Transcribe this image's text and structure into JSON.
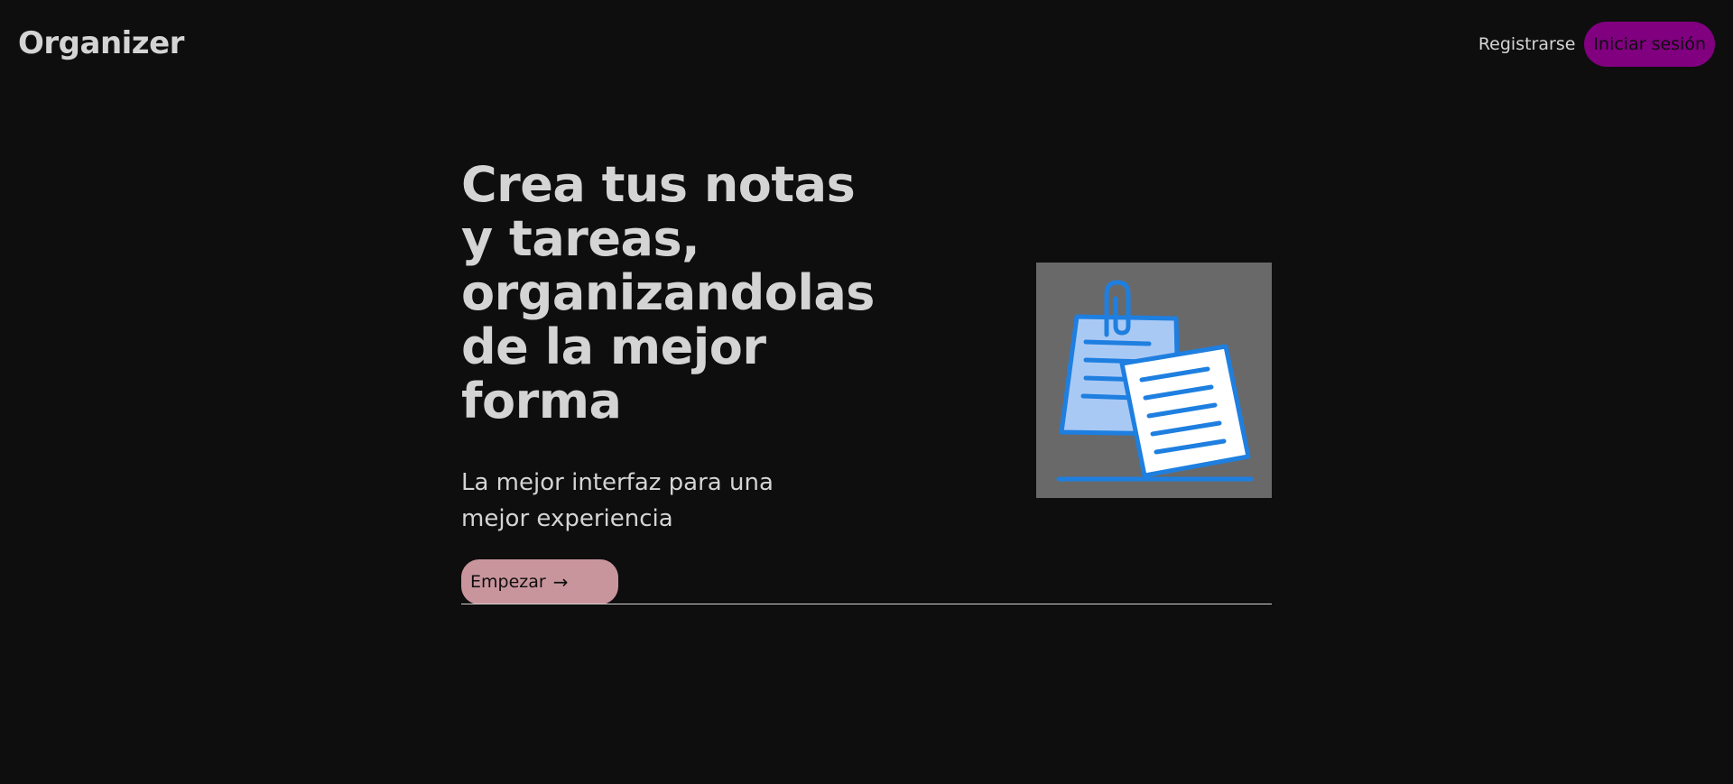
{
  "nav": {
    "logo": "Organizer",
    "register_label": "Registrarse",
    "login_label": "Iniciar sesión"
  },
  "hero": {
    "title": "Crea tus notas y tareas, organizandolas de la mejor forma",
    "subtitle": "La mejor interfaz para una mejor experiencia",
    "start_label": "Empezar",
    "start_icon": "arrow-right-icon",
    "illustration_icon": "notes-with-paperclip-icon"
  },
  "colors": {
    "background": "#0e0e0e",
    "text": "#d4d4d4",
    "login_accent": "#800080",
    "start_accent": "#c9959d",
    "illustration_bg": "#696969",
    "illustration_blue": "#1e7fe0",
    "illustration_light_blue": "#a9c9f5"
  }
}
